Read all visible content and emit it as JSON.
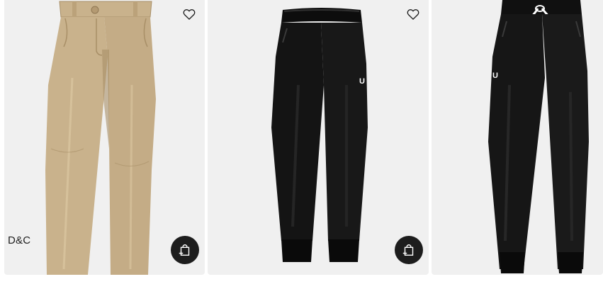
{
  "products": [
    {
      "badge": "D&C",
      "wishlist_icon": "heart-outline-icon",
      "quick_add_icon": "bag-plus-icon",
      "colors": {
        "fabric": "#c9b28c",
        "shadow": "#a88f67",
        "light": "#dcc8a2"
      }
    },
    {
      "wishlist_icon": "heart-outline-icon",
      "quick_add_icon": "bag-plus-icon",
      "colors": {
        "fabric": "#141414",
        "shadow": "#050505",
        "light": "#262626"
      }
    },
    {
      "colors": {
        "fabric": "#161616",
        "shadow": "#060606",
        "light": "#2a2a2a",
        "drawcord": "#ffffff"
      }
    }
  ],
  "theme": {
    "card_bg": "#f0f0f0",
    "button_bg": "#1d1d1d",
    "button_icon": "#ffffff",
    "heart_stroke": "#1d1d1d"
  }
}
